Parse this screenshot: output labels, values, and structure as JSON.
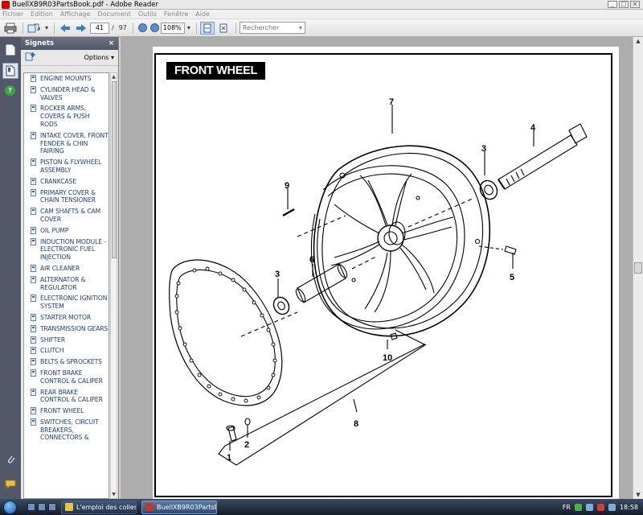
{
  "window": {
    "title": "BuellXB9R03PartsBook.pdf - Adobe Reader",
    "controls": [
      "_",
      "□",
      "×"
    ]
  },
  "menu": [
    "Fichier",
    "Edition",
    "Affichage",
    "Document",
    "Outils",
    "Fenêtre",
    "Aide"
  ],
  "toolbar": {
    "page_current": "41",
    "page_sep": "/",
    "page_total": "97",
    "zoom": "108%",
    "search_placeholder": "Rechercher"
  },
  "bookmarks": {
    "header": "Signets",
    "close": "×",
    "options_label": "Options",
    "items": [
      "ENGINE MOUNTS",
      "CYLINDER HEAD & VALVES",
      "ROCKER ARMS, COVERS & PUSH RODS",
      "INTAKE COVER, FRONT FENDER & CHIN FAIRING",
      "PISTON & FLYWHEEL ASSEMBLY",
      "CRANKCASE",
      "PRIMARY COVER & CHAIN TENSIONER",
      "CAM SHAFTS & CAM COVER",
      "OIL PUMP",
      "INDUCTION MODULE - ELECTRONIC FUEL INJECTION",
      "AIR CLEANER",
      "ALTERNATOR & REGULATOR",
      "ELECTRONIC IGNITION SYSTEM",
      "STARTER MOTOR",
      "TRANSMISSION GEARS",
      "SHIFTER",
      "CLUTCH",
      "BELTS & SPROCKETS",
      "FRONT BRAKE CONTROL & CALIPER",
      "REAR BRAKE CONTROL & CALIPER",
      "FRONT WHEEL",
      "SWITCHES, CIRCUIT BREAKERS, CONNECTORS &"
    ]
  },
  "document": {
    "heading": "FRONT WHEEL",
    "callouts": [
      "1",
      "2",
      "3",
      "3",
      "4",
      "5",
      "6",
      "7",
      "8",
      "9",
      "10"
    ]
  },
  "taskbar": {
    "tasks": [
      "L'emploi des colles ...",
      "BuellXB9R03PartsBo..."
    ],
    "language": "FR",
    "clock": "18:58"
  }
}
